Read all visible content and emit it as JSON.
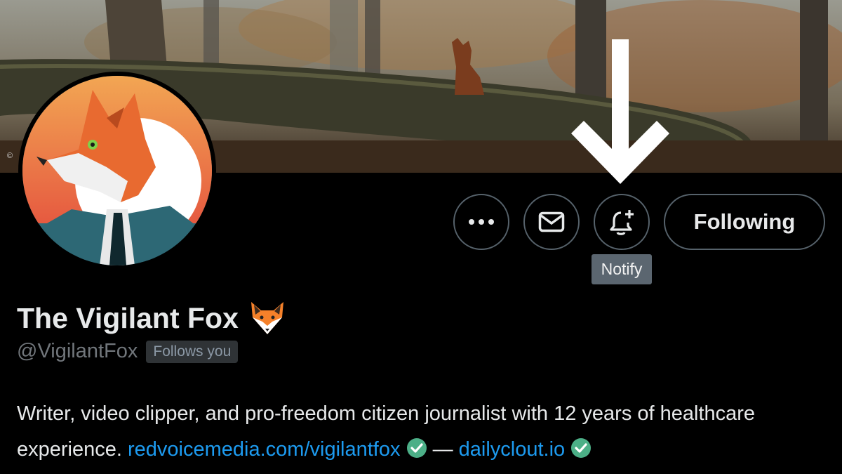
{
  "banner": {
    "copyright": "©"
  },
  "actions": {
    "more_label": "•••",
    "following_label": "Following",
    "notify_tooltip": "Notify"
  },
  "profile": {
    "display_name": "The Vigilant Fox",
    "name_emoji": "fox-face-emoji",
    "handle": "@VigilantFox",
    "follows_badge": "Follows you",
    "bio_text": "Writer, video clipper, and pro-freedom citizen journalist with 12 years of healthcare experience.",
    "link1": "redvoicemedia.com/vigilantfox",
    "separator": "—",
    "link2": "dailyclout.io"
  },
  "colors": {
    "background": "#000000",
    "link": "#1d9bf0",
    "check_badge": "#4caf87",
    "tooltip_bg": "#5b6670",
    "button_border": "#56626b"
  },
  "icons": [
    "more-icon",
    "envelope-icon",
    "bell-plus-icon",
    "check-circle-icon",
    "arrow-down-icon"
  ]
}
